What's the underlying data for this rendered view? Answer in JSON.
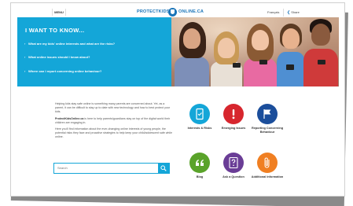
{
  "topbar": {
    "menu_label": "MENU",
    "logo_left": "PROTECTKIDS",
    "logo_right": "ONLINE.CA",
    "lang_label": "Français",
    "share_label": "Share"
  },
  "hero": {
    "title": "I WANT TO KNOW...",
    "questions": [
      "What are my kids' online interests and what are the risks?",
      "What online issues should I know about?",
      "Where can I report concerning online behaviour?"
    ]
  },
  "intro": {
    "p1": "Helping kids stay safe online is something many parents are concerned about. Yet, as a parent, it can be difficult to stay up to date with new technology and how to best protect your kids.",
    "p2_brand": "ProtectKidsOnline.ca",
    "p2_rest": " is here to help parents/guardians stay on top of the digital world their children are engaging in.",
    "p3": "Here you'll find information about the ever-changing online interests of young people, the potential risks they face and proactive strategies to help keep your child/adolescent safe while online."
  },
  "search": {
    "placeholder": "Search"
  },
  "tiles": [
    {
      "label": "Interests & Risks",
      "color": "#14a6d8",
      "icon": "tablet-icon"
    },
    {
      "label": "Emerging Issues",
      "color": "#d7262e",
      "icon": "exclamation-icon"
    },
    {
      "label": "Reporting Concerning Behaviour",
      "color": "#1b4e9b",
      "icon": "flag-icon"
    },
    {
      "label": "Blog",
      "color": "#5aa32a",
      "icon": "quote-icon"
    },
    {
      "label": "Ask a Question",
      "color": "#6a3d96",
      "icon": "question-icon"
    },
    {
      "label": "Additional Information",
      "color": "#f07f22",
      "icon": "paperclip-icon"
    }
  ]
}
